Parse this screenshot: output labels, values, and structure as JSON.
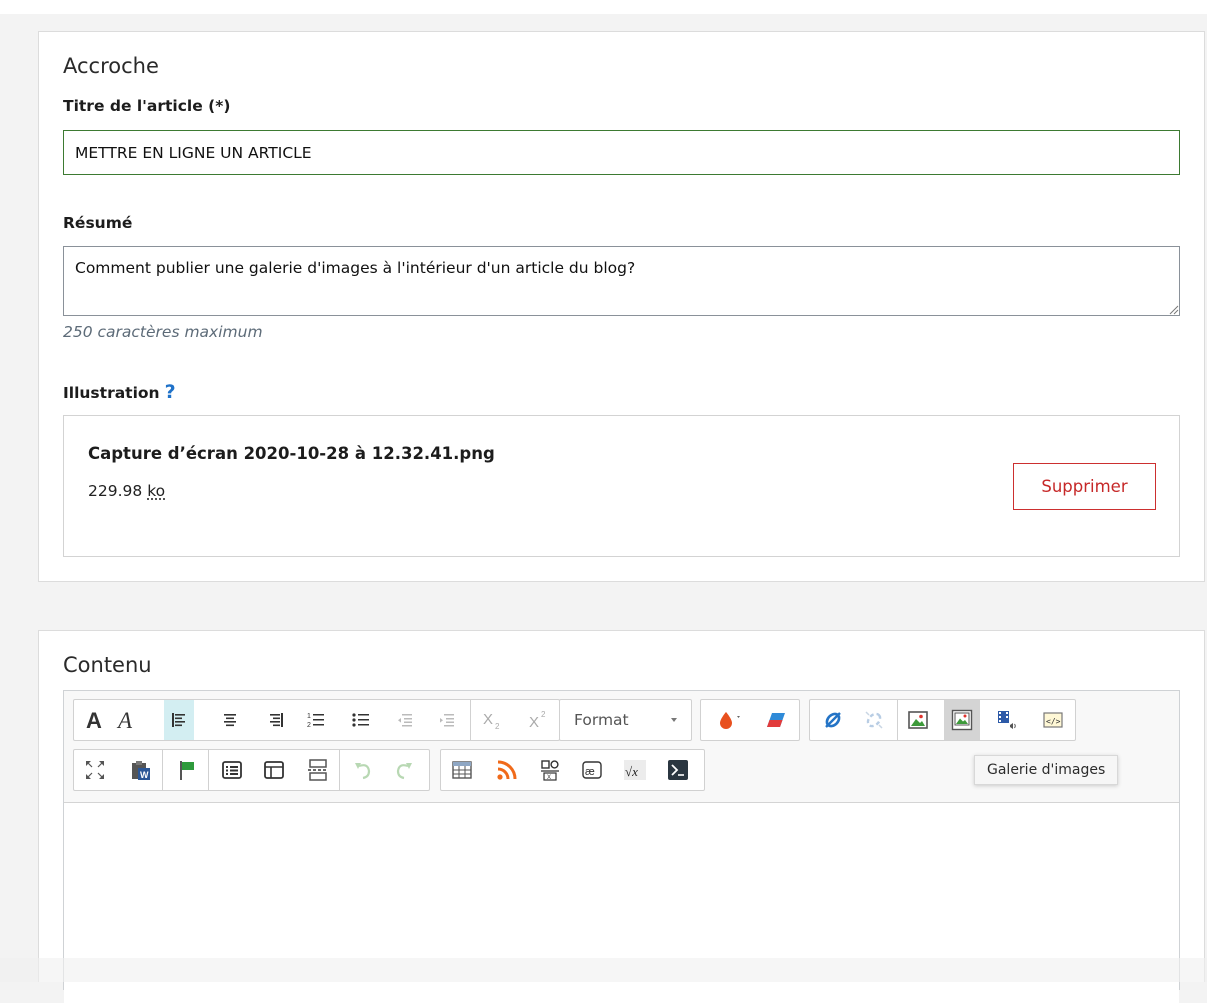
{
  "colors": {
    "accent_green": "#3d7a32",
    "danger": "#c62828",
    "link_blue": "#1f72c9",
    "active_tool": "#d3eef2"
  },
  "accroche": {
    "heading": "Accroche",
    "title_label": "Titre de l'article (*)",
    "title_value": "METTRE EN LIGNE UN ARTICLE",
    "summary_label": "Résumé",
    "summary_value": "Comment publier une galerie d'images à l'intérieur d'un article du blog?",
    "summary_hint": "250 caractères maximum",
    "illustration_label": "Illustration",
    "illustration_help": "?",
    "file": {
      "name": "Capture d’écran 2020-10-28 à 12.32.41.png",
      "size_value": "229.98",
      "size_unit": "ko",
      "delete_label": "Supprimer"
    }
  },
  "contenu": {
    "heading": "Contenu",
    "format_label": "Format",
    "tooltip": "Galerie d'images",
    "toolbar_row1": [
      "bold",
      "italic",
      "align-left",
      "align-center",
      "align-right",
      "numbered-list",
      "bulleted-list",
      "outdent",
      "indent",
      "subscript",
      "superscript",
      "text-color",
      "remove-format",
      "link",
      "unlink",
      "image",
      "image-gallery",
      "video",
      "source"
    ],
    "toolbar_row2": [
      "maximize",
      "paste-from-word",
      "anchor",
      "list-block",
      "template",
      "page-break",
      "undo",
      "redo",
      "table",
      "rss",
      "special-char-box",
      "ligature-ae",
      "math-formula",
      "terminal"
    ]
  }
}
